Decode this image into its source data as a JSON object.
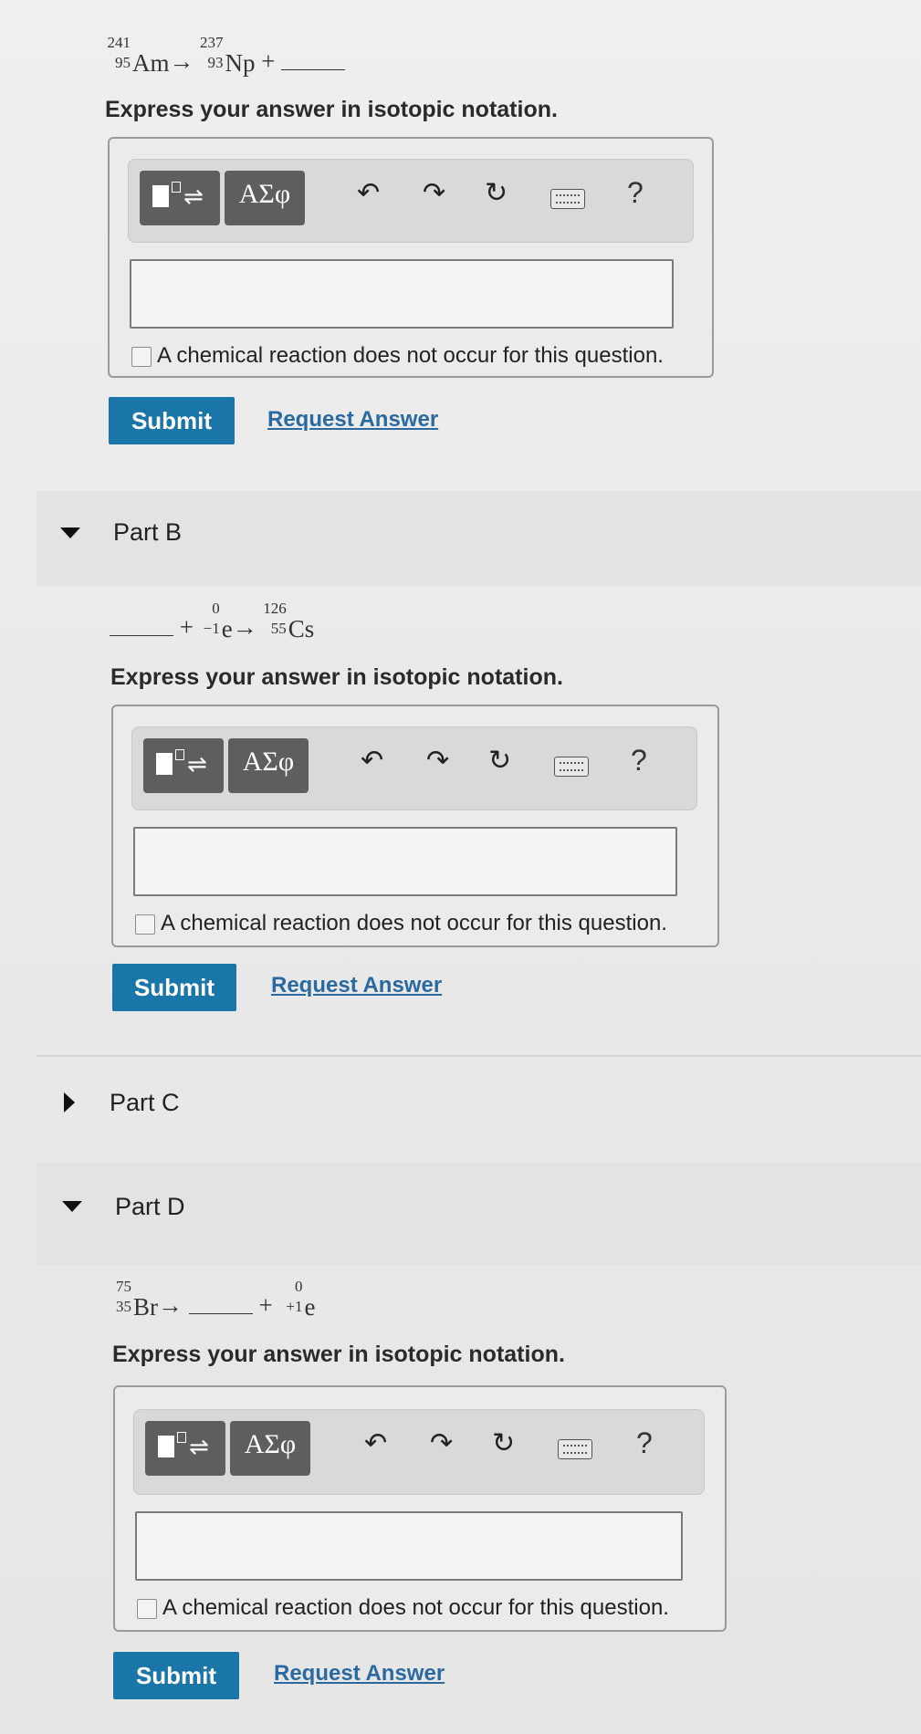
{
  "partA": {
    "equation": {
      "r1": {
        "mass": "241",
        "atomic": "95",
        "symbol": "Am"
      },
      "arrow": "→",
      "p1": {
        "mass": "237",
        "atomic": "93",
        "symbol": "Np"
      },
      "plus": "+"
    },
    "prompt": "Express your answer in isotopic notation.",
    "toolbar": {
      "greek": "ΑΣφ",
      "help": "?"
    },
    "checkbox_label": "A chemical reaction does not occur for this question.",
    "submit": "Submit",
    "request": "Request Answer"
  },
  "partB": {
    "title": "Part B",
    "equation": {
      "plus": "+",
      "r2": {
        "mass": "0",
        "atomic": "−1",
        "symbol": "e"
      },
      "arrow": "→",
      "p1": {
        "mass": "126",
        "atomic": "55",
        "symbol": "Cs"
      }
    },
    "prompt": "Express your answer in isotopic notation.",
    "toolbar": {
      "greek": "ΑΣφ",
      "help": "?"
    },
    "checkbox_label": "A chemical reaction does not occur for this question.",
    "submit": "Submit",
    "request": "Request Answer"
  },
  "partC": {
    "title": "Part C"
  },
  "partD": {
    "title": "Part D",
    "equation": {
      "r1": {
        "mass": "75",
        "atomic": "35",
        "symbol": "Br"
      },
      "arrow": "→",
      "plus": "+",
      "p2": {
        "mass": "0",
        "atomic": "+1",
        "symbol": "e"
      }
    },
    "prompt": "Express your answer in isotopic notation.",
    "toolbar": {
      "greek": "ΑΣφ",
      "help": "?"
    },
    "checkbox_label": "A chemical reaction does not occur for this question.",
    "submit": "Submit",
    "request": "Request Answer"
  },
  "colors": {
    "submit": "#1a76a8",
    "link": "#2a6aa0",
    "toolbar_button": "#5e5e5e"
  }
}
